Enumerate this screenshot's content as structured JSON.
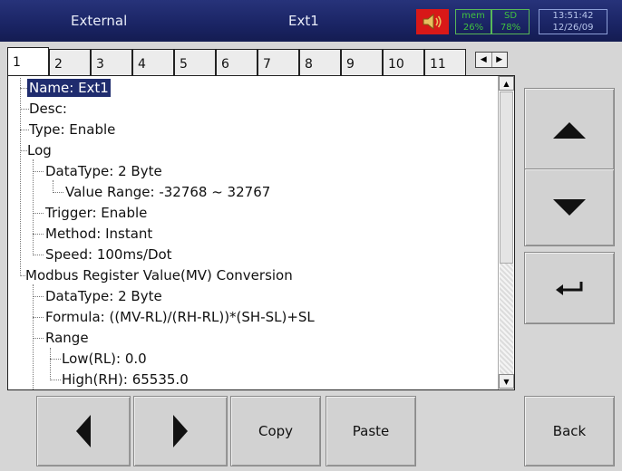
{
  "header": {
    "left_label": "External",
    "center_label": "Ext1",
    "speaker_icon": "speaker-icon",
    "mem_label": "mem",
    "mem_value": "26%",
    "sd_label": "SD",
    "sd_value": "78%",
    "time": "13:51:42",
    "date": "12/26/09",
    "alarm_color": "#d81818"
  },
  "tabs": [
    "1",
    "2",
    "3",
    "4",
    "5",
    "6",
    "7",
    "8",
    "9",
    "10",
    "11"
  ],
  "active_tab": "1",
  "tree": [
    {
      "text": "Name: Ext1"
    },
    {
      "text": "Desc:"
    },
    {
      "text": "Type: Enable"
    },
    {
      "text": "Log"
    },
    {
      "text": "DataType: 2 Byte"
    },
    {
      "text": "Value Range: -32768 ~ 32767"
    },
    {
      "text": "Trigger: Enable"
    },
    {
      "text": "Method: Instant"
    },
    {
      "text": "Speed: 100ms/Dot"
    },
    {
      "text": "Modbus Register Value(MV) Conversion"
    },
    {
      "text": "DataType: 2 Byte"
    },
    {
      "text": "Formula: ((MV-RL)/(RH-RL))*(SH-SL)+SL"
    },
    {
      "text": "Range"
    },
    {
      "text": "Low(RL): 0.0"
    },
    {
      "text": "High(RH): 65535.0"
    }
  ],
  "side_buttons": {
    "up_icon": "triangle-up-icon",
    "down_icon": "triangle-down-icon",
    "enter_icon": "enter-arrow-icon"
  },
  "bottom_buttons": {
    "prev_icon": "triangle-left-icon",
    "next_icon": "triangle-right-icon",
    "copy": "Copy",
    "paste": "Paste",
    "back": "Back"
  }
}
